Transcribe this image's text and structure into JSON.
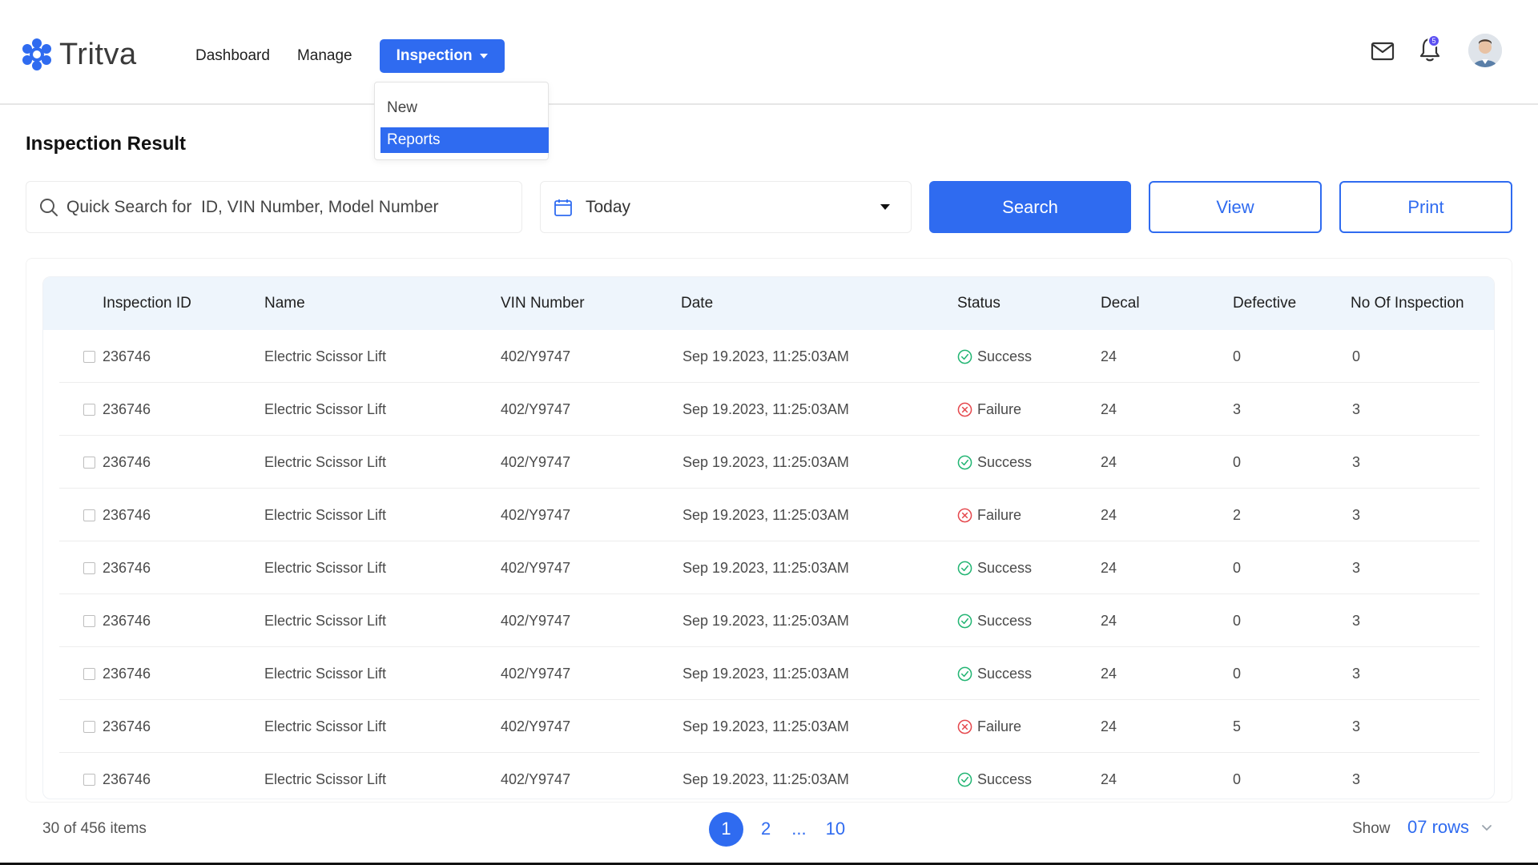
{
  "brand": {
    "name": "Tritva"
  },
  "nav": {
    "dashboard": "Dashboard",
    "manage": "Manage",
    "inspection": "Inspection",
    "dropdown": [
      "New",
      "Reports"
    ]
  },
  "header": {
    "notification_count": "5"
  },
  "page": {
    "title": "Inspection Result"
  },
  "toolbar": {
    "search_placeholder": "Quick Search for  ID, VIN Number, Model Number",
    "date_value": "Today",
    "search_label": "Search",
    "view_label": "View",
    "print_label": "Print"
  },
  "table": {
    "columns": [
      "Inspection ID",
      "Name",
      "VIN Number",
      "Date",
      "Status",
      "Decal",
      "Defective",
      "No Of Inspection"
    ],
    "rows": [
      {
        "id": "236746",
        "name": "Electric Scissor Lift",
        "vin": "402/Y9747",
        "date": "Sep 19.2023, 11:25:03AM",
        "status": "Success",
        "decal": "24",
        "defective": "0",
        "inspections": "0"
      },
      {
        "id": "236746",
        "name": "Electric Scissor Lift",
        "vin": "402/Y9747",
        "date": "Sep 19.2023, 11:25:03AM",
        "status": "Failure",
        "decal": "24",
        "defective": "3",
        "inspections": "3"
      },
      {
        "id": "236746",
        "name": "Electric Scissor Lift",
        "vin": "402/Y9747",
        "date": "Sep 19.2023, 11:25:03AM",
        "status": "Success",
        "decal": "24",
        "defective": "0",
        "inspections": "3"
      },
      {
        "id": "236746",
        "name": "Electric Scissor Lift",
        "vin": "402/Y9747",
        "date": "Sep 19.2023, 11:25:03AM",
        "status": "Failure",
        "decal": "24",
        "defective": "2",
        "inspections": "3"
      },
      {
        "id": "236746",
        "name": "Electric Scissor Lift",
        "vin": "402/Y9747",
        "date": "Sep 19.2023, 11:25:03AM",
        "status": "Success",
        "decal": "24",
        "defective": "0",
        "inspections": "3"
      },
      {
        "id": "236746",
        "name": "Electric Scissor Lift",
        "vin": "402/Y9747",
        "date": "Sep 19.2023, 11:25:03AM",
        "status": "Success",
        "decal": "24",
        "defective": "0",
        "inspections": "3"
      },
      {
        "id": "236746",
        "name": "Electric Scissor Lift",
        "vin": "402/Y9747",
        "date": "Sep 19.2023, 11:25:03AM",
        "status": "Success",
        "decal": "24",
        "defective": "0",
        "inspections": "3"
      },
      {
        "id": "236746",
        "name": "Electric Scissor Lift",
        "vin": "402/Y9747",
        "date": "Sep 19.2023, 11:25:03AM",
        "status": "Failure",
        "decal": "24",
        "defective": "5",
        "inspections": "3"
      },
      {
        "id": "236746",
        "name": "Electric Scissor Lift",
        "vin": "402/Y9747",
        "date": "Sep 19.2023, 11:25:03AM",
        "status": "Success",
        "decal": "24",
        "defective": "0",
        "inspections": "3"
      }
    ]
  },
  "footer": {
    "count": "30 of 456 items",
    "pages": [
      "1",
      "2",
      "...",
      "10"
    ],
    "show_label": "Show",
    "rows_value": "07 rows"
  },
  "colors": {
    "accent": "#2f6bf0",
    "success": "#22b573",
    "failure": "#e5484d",
    "header_bg": "#eef5fc"
  },
  "icons": {
    "logo": "hexagon-flower-icon",
    "mail": "mail-icon",
    "bell": "bell-icon",
    "search": "search-icon",
    "calendar": "calendar-icon",
    "success": "check-circle-icon",
    "failure": "x-circle-icon"
  }
}
